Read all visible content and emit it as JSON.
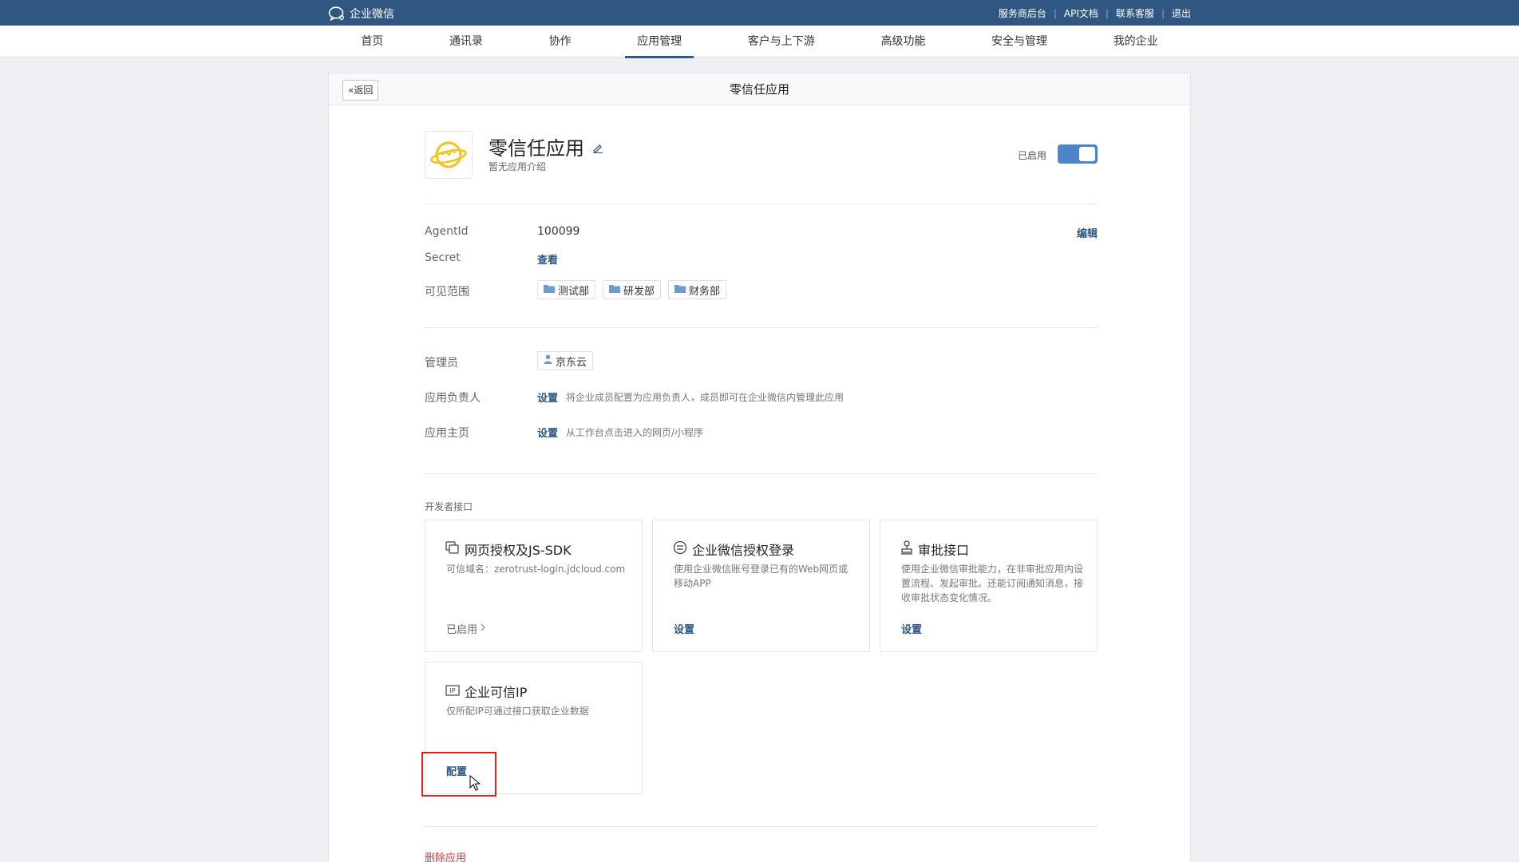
{
  "topbar": {
    "brand": "企业微信",
    "links": [
      "服务商后台",
      "API文档",
      "联系客服",
      "退出"
    ]
  },
  "nav": {
    "items": [
      "首页",
      "通讯录",
      "协作",
      "应用管理",
      "客户与上下游",
      "高级功能",
      "安全与管理",
      "我的企业"
    ],
    "active": "应用管理"
  },
  "panel": {
    "back_label": "返回",
    "title": "零信任应用"
  },
  "app": {
    "name": "零信任应用",
    "description": "暂无应用介绍",
    "status_label": "已启用",
    "enabled": true
  },
  "info": {
    "agentid_label": "AgentId",
    "agentid_value": "100099",
    "edit_label": "编辑",
    "secret_label": "Secret",
    "secret_action": "查看",
    "scope_label": "可见范围",
    "scope_tags": [
      "测试部",
      "研发部",
      "财务部"
    ]
  },
  "admin": {
    "admin_label": "管理员",
    "admin_value": "京东云",
    "owner_label": "应用负责人",
    "owner_action": "设置",
    "owner_hint": "将企业成员配置为应用负责人，成员即可在企业微信内管理此应用",
    "home_label": "应用主页",
    "home_action": "设置",
    "home_hint": "从工作台点击进入的网页/小程序"
  },
  "developer": {
    "section_title": "开发者接口",
    "cards": [
      {
        "title": "网页授权及JS-SDK",
        "desc": "可信域名：zerotrust-login.jdcloud.com",
        "action": "已启用"
      },
      {
        "title": "企业微信授权登录",
        "desc": "使用企业微信账号登录已有的Web网页或移动APP",
        "action": "设置"
      },
      {
        "title": "审批接口",
        "desc": "使用企业微信审批能力，在非审批应用内设置流程、发起审批。还能订阅通知消息，接收审批状态变化情况。",
        "action": "设置"
      },
      {
        "title": "企业可信IP",
        "desc": "仅所配IP可通过接口获取企业数据",
        "action": "配置"
      }
    ]
  },
  "delete_label": "删除应用",
  "colors": {
    "topbar": "#2f5782",
    "accent": "#2f5782",
    "toggle": "#4c85c8",
    "danger": "#e0353b",
    "highlight": "#e0201b"
  }
}
